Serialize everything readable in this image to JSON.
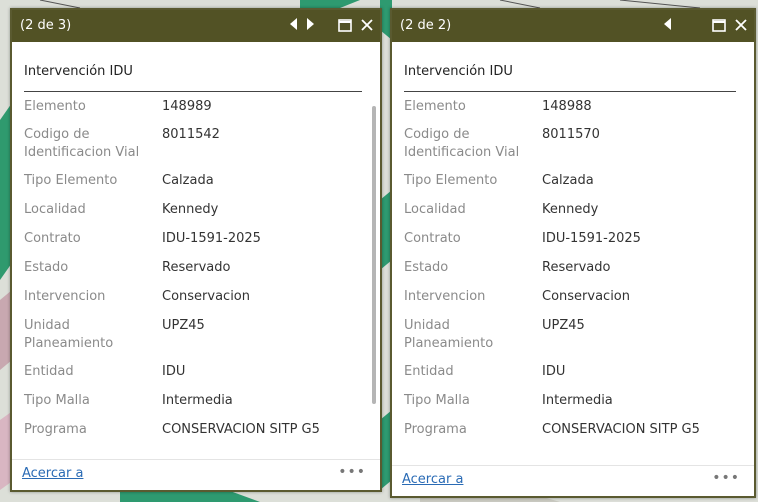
{
  "popups": [
    {
      "counter": "(2 de 3)",
      "section_title": "Intervención IDU",
      "rows": [
        {
          "label": "Elemento",
          "value": "148989"
        },
        {
          "label": "Codigo de Identificacion Vial",
          "value": "8011542"
        },
        {
          "label": "Tipo Elemento",
          "value": "Calzada"
        },
        {
          "label": "Localidad",
          "value": "Kennedy"
        },
        {
          "label": "Contrato",
          "value": "IDU-1591-2025"
        },
        {
          "label": "Estado",
          "value": "Reservado"
        },
        {
          "label": "Intervencion",
          "value": "Conservacion"
        },
        {
          "label": "Unidad Planeamiento",
          "value": "UPZ45"
        },
        {
          "label": "Entidad",
          "value": "IDU"
        },
        {
          "label": "Tipo Malla",
          "value": "Intermedia"
        },
        {
          "label": "Programa",
          "value": "CONSERVACION SITP G5"
        }
      ],
      "footer_link": "Acercar a",
      "more_label": "•••",
      "has_next": true
    },
    {
      "counter": "(2 de 2)",
      "section_title": "Intervención IDU",
      "rows": [
        {
          "label": "Elemento",
          "value": "148988"
        },
        {
          "label": "Codigo de Identificacion Vial",
          "value": "8011570"
        },
        {
          "label": "Tipo Elemento",
          "value": "Calzada"
        },
        {
          "label": "Localidad",
          "value": "Kennedy"
        },
        {
          "label": "Contrato",
          "value": "IDU-1591-2025"
        },
        {
          "label": "Estado",
          "value": "Reservado"
        },
        {
          "label": "Intervencion",
          "value": "Conservacion"
        },
        {
          "label": "Unidad Planeamiento",
          "value": "UPZ45"
        },
        {
          "label": "Entidad",
          "value": "IDU"
        },
        {
          "label": "Tipo Malla",
          "value": "Intermedia"
        },
        {
          "label": "Programa",
          "value": "CONSERVACION SITP G5"
        }
      ],
      "footer_link": "Acercar a",
      "more_label": "•••",
      "has_next": false
    }
  ],
  "colors": {
    "titlebar": "#525225",
    "border": "#5a5a30",
    "link": "#2a6bb5",
    "label_text": "#8a8a8a",
    "value_text": "#333333"
  }
}
